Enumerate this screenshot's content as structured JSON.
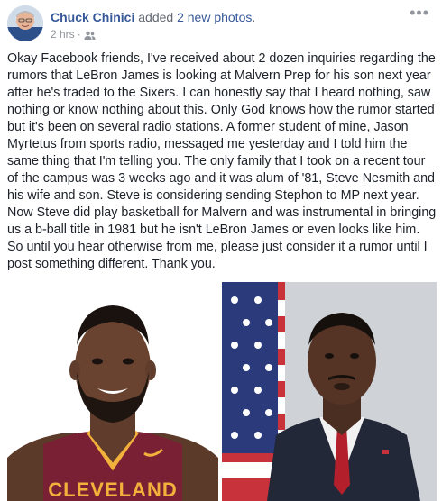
{
  "post": {
    "author": "Chuck Chinici",
    "action_prefix": "added",
    "action_link": "2 new photos",
    "action_suffix": ".",
    "time": "2 hrs",
    "separator": "·",
    "audience_icon": "friends-icon",
    "more_icon": "more-options-icon",
    "text": "Okay Facebook friends, I've received about 2 dozen inquiries regarding the rumors that LeBron James is looking at Malvern Prep for his son next year after he's traded to the Sixers. I can honestly say that I heard nothing, saw nothing or know nothing about this. Only God knows how the rumor started but it's been on several radio stations. A former student of mine, Jason Myrtetus from sports radio, messaged me yesterday and I told him the same thing that I'm telling you. The only family that I took on a recent tour of the campus was 3 weeks ago and it was alum of '81, Steve Nesmith and his wife and son. Steve is considering sending Stephon to MP next year. Now Steve did play basketball for Malvern and was instrumental in bringing us a b-ball title in 1981 but he isn't LeBron James or even looks like him. So until you hear otherwise from me, please just consider it a rumor until I post something different. Thank you."
  },
  "photos": {
    "left": {
      "jersey_text": "CLEVELAND"
    }
  },
  "colors": {
    "link": "#365899",
    "text": "#1d2129",
    "muted": "#90949c",
    "jersey": "#7a2035"
  }
}
